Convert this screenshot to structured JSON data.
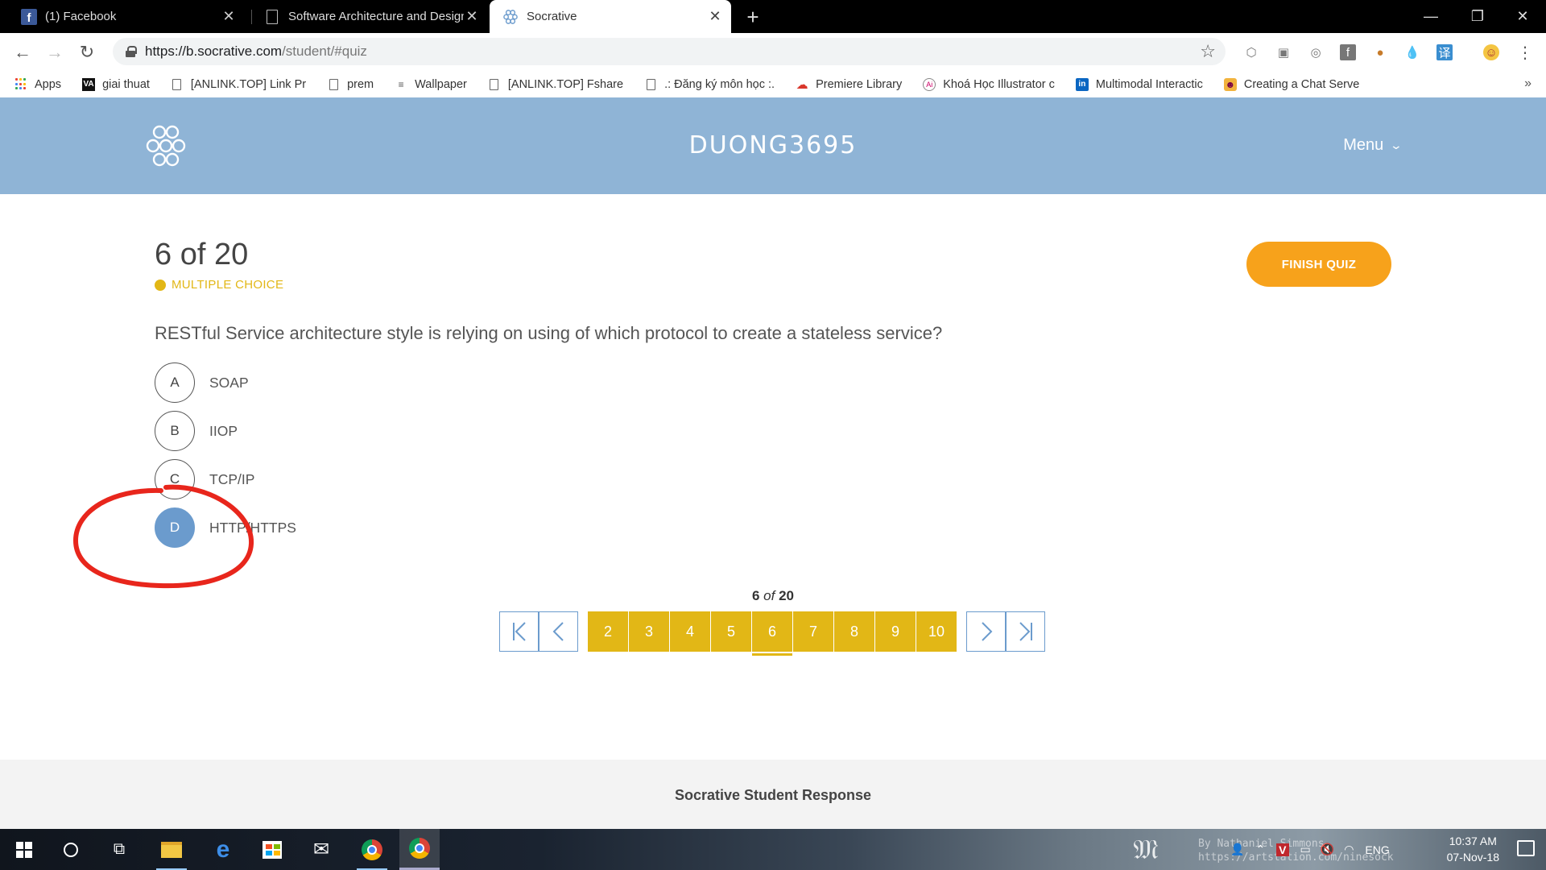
{
  "browser": {
    "tabs": [
      {
        "title": "(1) Facebook",
        "icon": "facebook-icon",
        "active": false
      },
      {
        "title": "Software Architecture and Design",
        "icon": "document-icon",
        "active": false
      },
      {
        "title": "Socrative",
        "icon": "socrative-icon",
        "active": true
      }
    ],
    "url": {
      "host": "https://b.socrative.com",
      "path": "/student/#quiz"
    },
    "bookmarks": [
      {
        "label": "Apps",
        "icon": "apps-grid-icon"
      },
      {
        "label": "giai thuat",
        "icon": "va-icon"
      },
      {
        "label": "[ANLINK.TOP] Link Pr",
        "icon": "document-icon"
      },
      {
        "label": "prem",
        "icon": "document-icon"
      },
      {
        "label": "Wallpaper",
        "icon": "wallpaper-icon"
      },
      {
        "label": "[ANLINK.TOP] Fshare",
        "icon": "document-icon"
      },
      {
        "label": ".: Đăng ký môn học :.",
        "icon": "document-icon"
      },
      {
        "label": "Premiere Library",
        "icon": "cloud-icon"
      },
      {
        "label": "Khoá Học Illustrator c",
        "icon": "illustrator-icon"
      },
      {
        "label": "Multimodal Interactic",
        "icon": "linkedin-icon"
      },
      {
        "label": "Creating a Chat Serve",
        "icon": "chat-icon"
      }
    ],
    "more_bookmarks": "»"
  },
  "app": {
    "room_name": "DUONG3695",
    "menu_label": "Menu",
    "progress": "6 of 20",
    "question_type": "MULTIPLE CHOICE",
    "finish_label": "FINISH QUIZ",
    "question": "RESTful Service architecture style is relying on using of which protocol to create a stateless service?",
    "answers": [
      {
        "letter": "A",
        "text": "SOAP",
        "selected": false
      },
      {
        "letter": "B",
        "text": "IIOP",
        "selected": false
      },
      {
        "letter": "C",
        "text": "TCP/IP",
        "selected": false
      },
      {
        "letter": "D",
        "text": "HTTP/HTTPS",
        "selected": true
      }
    ],
    "pager": {
      "current": "6",
      "of_word": "of",
      "total": "20",
      "pages": [
        "2",
        "3",
        "4",
        "5",
        "6",
        "7",
        "8",
        "9",
        "10"
      ]
    },
    "footer": "Socrative Student Response"
  },
  "taskbar": {
    "watermark_line1": "By Nathaniel Simmons",
    "watermark_line2": "https://artstation.com/ninesock",
    "language": "ENG",
    "time": "10:37 AM",
    "date": "07-Nov-18"
  },
  "colors": {
    "header_bg": "#8fb4d6",
    "accent_yellow": "#e2b716",
    "finish_orange": "#f7a21b",
    "selected_blue": "#6b9bcd",
    "annotation_red": "#e8261c"
  }
}
